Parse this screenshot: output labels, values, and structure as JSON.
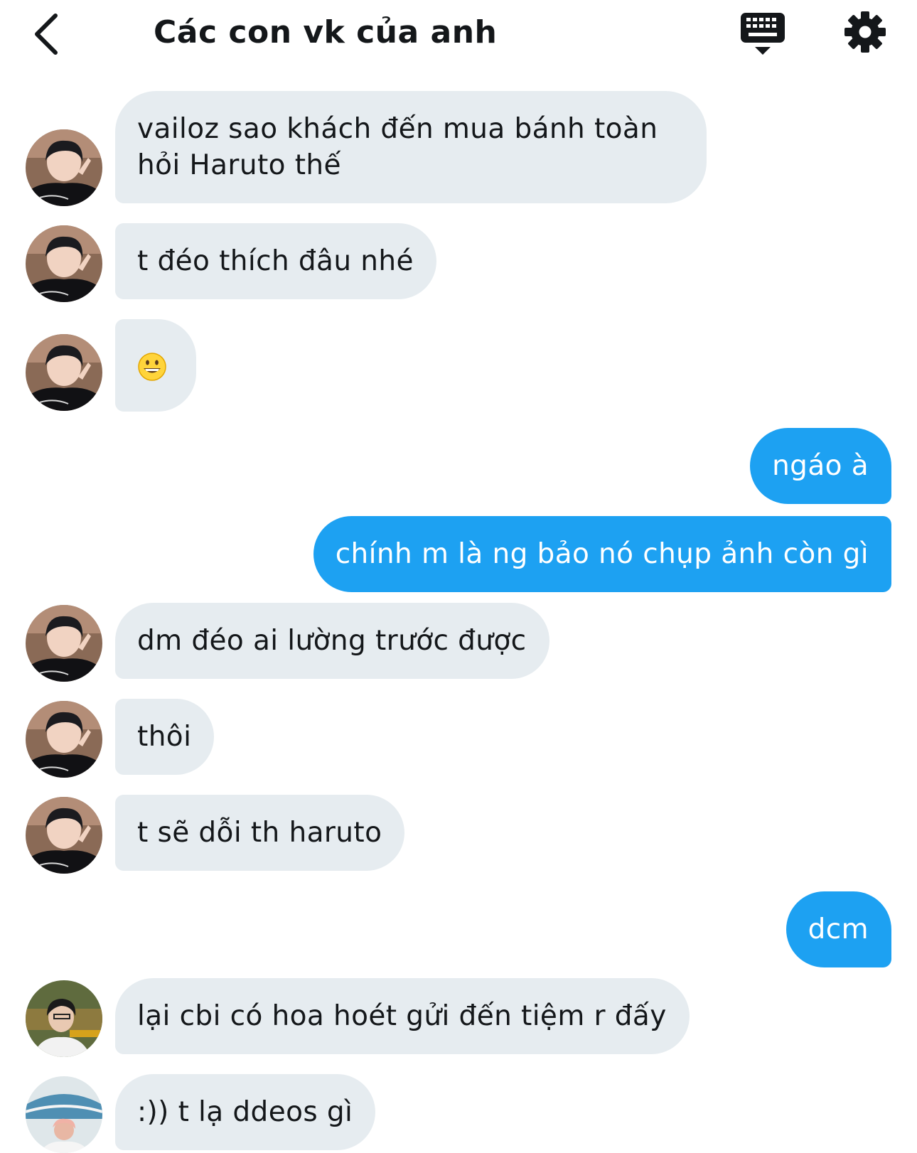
{
  "header": {
    "title": "Các con vk của anh",
    "back_icon": "chevron-left-icon",
    "keyboard_icon": "keyboard-icon",
    "settings_icon": "gear-icon"
  },
  "colors": {
    "incoming_bubble": "#e6ecf0",
    "outgoing_bubble": "#1da1f2",
    "text": "#14171a"
  },
  "messages": [
    {
      "side": "in",
      "avatar": "user-a",
      "text": "vailoz sao khách đến mua bánh toàn hỏi Haruto thế"
    },
    {
      "side": "in",
      "avatar": "user-a",
      "text": "t đéo thích đâu nhé"
    },
    {
      "side": "in",
      "avatar": "user-a",
      "text": "",
      "emoji": "grinning-face-emoji"
    },
    {
      "side": "out",
      "text": "ngáo à"
    },
    {
      "side": "out",
      "text": "chính m là ng bảo nó chụp ảnh còn gì"
    },
    {
      "side": "in",
      "avatar": "user-a",
      "text": "dm đéo ai lường trước được"
    },
    {
      "side": "in",
      "avatar": "user-a",
      "text": "thôi"
    },
    {
      "side": "in",
      "avatar": "user-a",
      "text": "t sẽ dỗi th haruto"
    },
    {
      "side": "out",
      "text": "dcm"
    },
    {
      "side": "in",
      "avatar": "user-b",
      "text": "lại cbi có hoa hoét gửi đến tiệm r đấy"
    },
    {
      "side": "in",
      "avatar": "user-c",
      "text": ":)) t lạ ddeos gì"
    }
  ]
}
